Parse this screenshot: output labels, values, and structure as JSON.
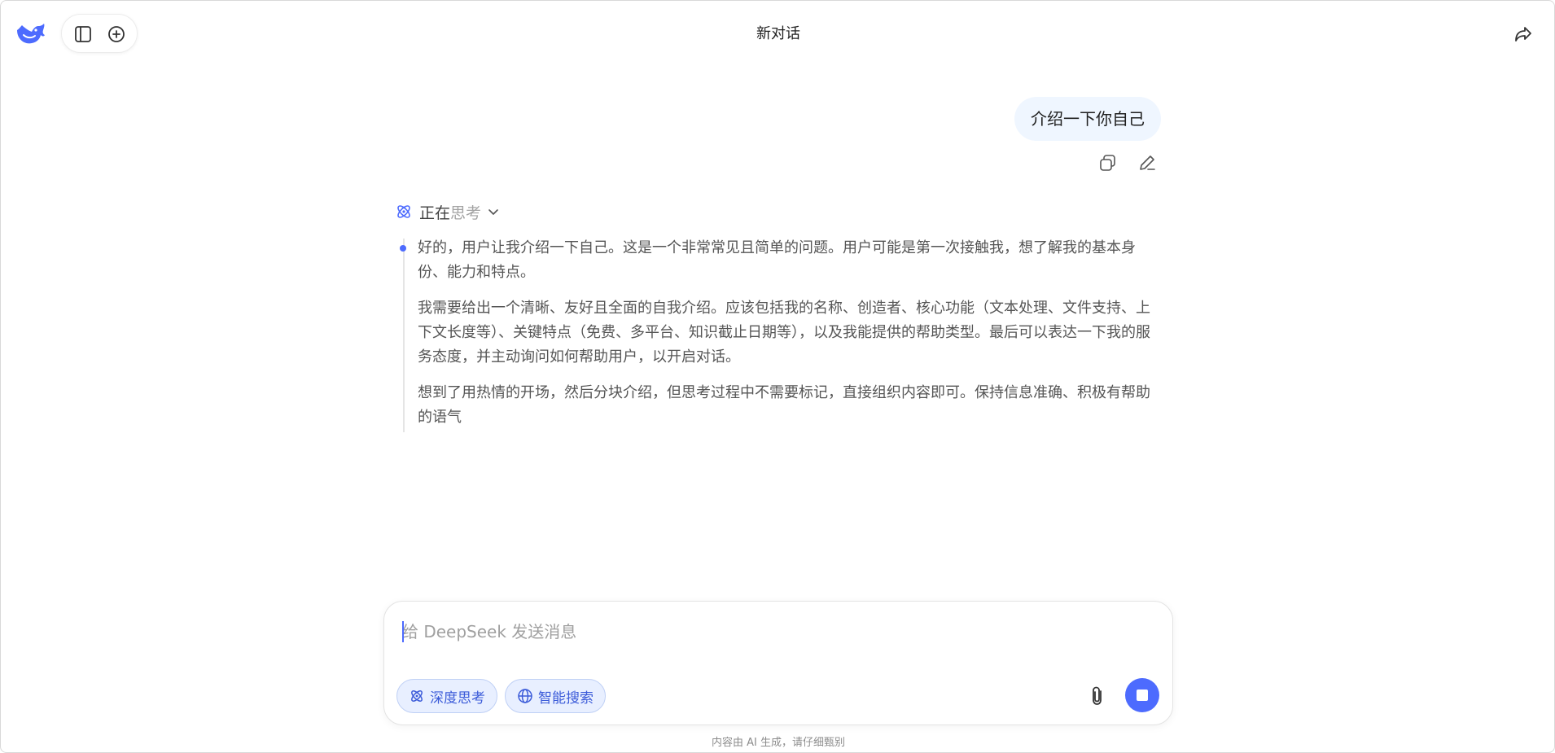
{
  "header": {
    "title": "新对话",
    "logo_icon": "deepseek-whale-icon",
    "sidebar_icon": "sidebar-toggle-icon",
    "new_chat_icon": "plus-circle-icon",
    "share_icon": "share-icon"
  },
  "conversation": {
    "user_message": "介绍一下你自己",
    "message_actions": [
      "copy-icon",
      "edit-icon"
    ],
    "thinking": {
      "label_active": "正在",
      "label_rest": "思考",
      "paragraphs": [
        "好的，用户让我介绍一下自己。这是一个非常常见且简单的问题。用户可能是第一次接触我，想了解我的基本身份、能力和特点。",
        "我需要给出一个清晰、友好且全面的自我介绍。应该包括我的名称、创造者、核心功能（文本处理、文件支持、上下文长度等）、关键特点（免费、多平台、知识截止日期等），以及我能提供的帮助类型。最后可以表达一下我的服务态度，并主动询问如何帮助用户，以开启对话。",
        "想到了用热情的开场，然后分块介绍，但思考过程中不需要标记，直接组织内容即可。保持信息准确、积极有帮助的语气"
      ]
    }
  },
  "composer": {
    "placeholder": "给 DeepSeek 发送消息",
    "value": "",
    "deep_think_label": "深度思考",
    "search_label": "智能搜索",
    "attach_icon": "paperclip-icon",
    "stop_icon": "stop-icon"
  },
  "footer": {
    "disclaimer": "内容由 AI 生成，请仔细甄别"
  },
  "colors": {
    "accent": "#4d6bfe",
    "user_bubble": "#eff6ff",
    "chip_bg": "#e8efff"
  }
}
